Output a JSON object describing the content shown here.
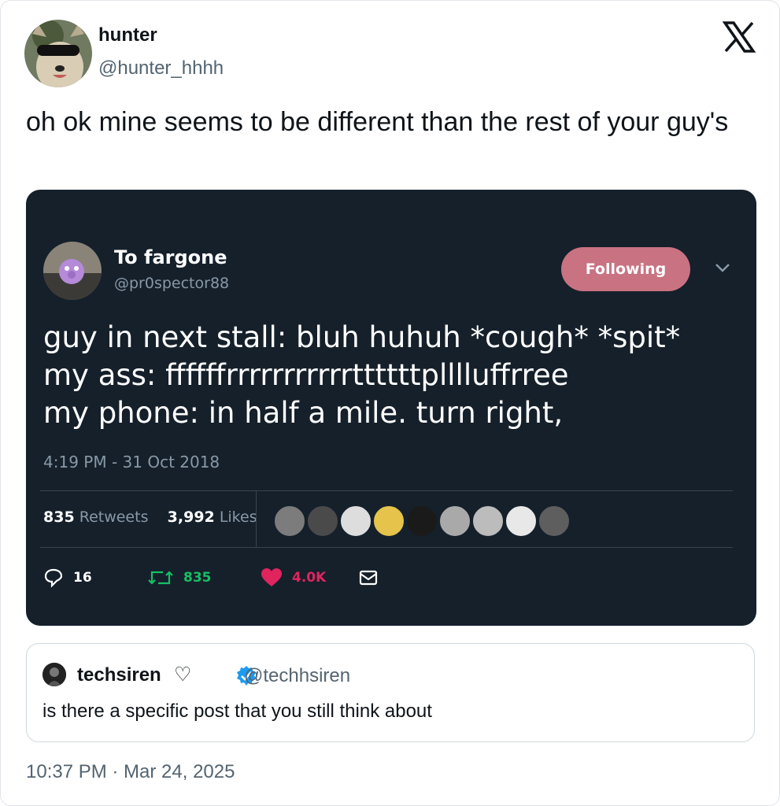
{
  "author": {
    "display_name": "hunter",
    "handle": "@hunter_hhhh"
  },
  "tweet": {
    "text": "oh ok mine seems to be different than the rest of your guy's",
    "timestamp": "10:37 PM · Mar 24, 2025"
  },
  "media_tweet": {
    "display_name": "To fargone",
    "handle": "@pr0spector88",
    "follow_label": "Following",
    "lines": [
      "guy in next stall: bluh huhuh *cough* *spit*",
      "my ass:  ffffffrrrrrrrrrrrttttttplllluffrree",
      "my phone: in half a mile. turn right,"
    ],
    "time": "4:19 PM - 31 Oct 2018",
    "retweets_count": "835",
    "retweets_label": "Retweets",
    "likes_count": "3,992",
    "likes_label": "Likes",
    "replies_action": "16",
    "retweets_action": "835",
    "likes_action": "4.0K",
    "colors": {
      "background": "#15202b",
      "follow_button": "#c97282",
      "retweet_green": "#17bf63",
      "like_red": "#e0245e"
    }
  },
  "quoted_tweet": {
    "display_name": "techsiren",
    "name_suffix": "♡",
    "handle": "@techhsiren",
    "text": "is there a specific post that you still think about",
    "verified_icon": "verified-badge-icon"
  },
  "icons": [
    "x-logo-icon",
    "chevron-down-icon",
    "reply-icon",
    "retweet-icon",
    "heart-icon",
    "message-icon",
    "verified-badge-icon"
  ]
}
